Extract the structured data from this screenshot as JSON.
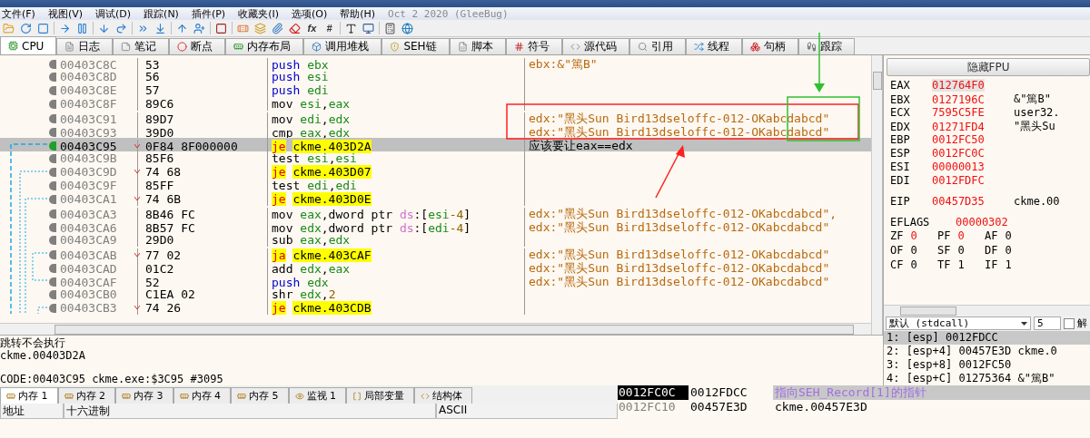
{
  "menu": {
    "items": [
      "文件(F)",
      "视图(V)",
      "调试(D)",
      "跟踪(N)",
      "插件(P)",
      "收藏夹(I)",
      "选项(O)",
      "帮助(H)"
    ],
    "build": "Oct 2 2020 (GleeBug)"
  },
  "toolbar": {
    "text_buttons": [
      "fx",
      "#"
    ]
  },
  "tabs": [
    {
      "label": "CPU",
      "selected": true
    },
    {
      "label": "日志",
      "selected": false
    },
    {
      "label": "笔记",
      "selected": false
    },
    {
      "label": "断点",
      "selected": false
    },
    {
      "label": "内存布局",
      "selected": false
    },
    {
      "label": "调用堆栈",
      "selected": false
    },
    {
      "label": "SEH链",
      "selected": false
    },
    {
      "label": "脚本",
      "selected": false
    },
    {
      "label": "符号",
      "selected": false
    },
    {
      "label": "源代码",
      "selected": false
    },
    {
      "label": "引用",
      "selected": false
    },
    {
      "label": "线程",
      "selected": false
    },
    {
      "label": "句柄",
      "selected": false
    },
    {
      "label": "跟踪",
      "selected": false
    }
  ],
  "disassembly": [
    {
      "address": "00403C8C",
      "bytes": "53",
      "selected": false,
      "kind": "stack",
      "mnemonic": "push",
      "operands": "ebx",
      "comment": {
        "text": "ebx:&\"篤B\"",
        "kind": "auto"
      }
    },
    {
      "address": "00403C8D",
      "bytes": "56",
      "selected": false,
      "kind": "stack",
      "mnemonic": "push",
      "operands": "esi"
    },
    {
      "address": "00403C8E",
      "bytes": "57",
      "selected": false,
      "kind": "stack",
      "mnemonic": "push",
      "operands": "edi"
    },
    {
      "address": "00403C8F",
      "bytes": "89C6",
      "selected": false,
      "kind": "plain",
      "mnemonic": "mov",
      "operands": "esi,eax"
    },
    {
      "address": "00403C91",
      "bytes": "89D7",
      "selected": false,
      "kind": "plain",
      "mnemonic": "mov",
      "operands": "edi,edx",
      "comment": {
        "text": "edx:\"黑头Sun Bird13dseloffc-012-OKabcdabcd\"",
        "kind": "auto"
      }
    },
    {
      "address": "00403C93",
      "bytes": "39D0",
      "selected": false,
      "kind": "plain",
      "mnemonic": "cmp",
      "operands": "eax,edx",
      "comment": {
        "text": "edx:\"黑头Sun Bird13dseloffc-012-OKabcdabcd\"",
        "kind": "auto"
      }
    },
    {
      "address": "00403C95",
      "bytes": "0F84 8F000000",
      "selected": true,
      "kind": "jump",
      "mnemonic": "je",
      "operands": "ckme.403D2A",
      "comment": {
        "text": "应该要让eax==edx",
        "kind": "user"
      }
    },
    {
      "address": "00403C9B",
      "bytes": "85F6",
      "selected": false,
      "kind": "plain",
      "mnemonic": "test",
      "operands": "esi,esi"
    },
    {
      "address": "00403C9D",
      "bytes": "74 68",
      "selected": false,
      "kind": "jump",
      "mnemonic": "je",
      "operands": "ckme.403D07"
    },
    {
      "address": "00403C9F",
      "bytes": "85FF",
      "selected": false,
      "kind": "plain",
      "mnemonic": "test",
      "operands": "edi,edi"
    },
    {
      "address": "00403CA1",
      "bytes": "74 6B",
      "selected": false,
      "kind": "jump",
      "mnemonic": "je",
      "operands": "ckme.403D0E"
    },
    {
      "address": "00403CA3",
      "bytes": "8B46 FC",
      "selected": false,
      "kind": "plain",
      "mnemonic": "mov",
      "operands": "eax,dword ptr ds:[esi-4]",
      "comment": {
        "text": "edx:\"黑头Sun Bird13dseloffc-012-OKabcdabcd\",",
        "kind": "auto"
      }
    },
    {
      "address": "00403CA6",
      "bytes": "8B57 FC",
      "selected": false,
      "kind": "plain",
      "mnemonic": "mov",
      "operands": "edx,dword ptr ds:[edi-4]",
      "comment": {
        "text": "edx:\"黑头Sun Bird13dseloffc-012-OKabcdabcd\"",
        "kind": "auto"
      }
    },
    {
      "address": "00403CA9",
      "bytes": "29D0",
      "selected": false,
      "kind": "plain",
      "mnemonic": "sub",
      "operands": "eax,edx"
    },
    {
      "address": "00403CAB",
      "bytes": "77 02",
      "selected": false,
      "kind": "jump",
      "mnemonic": "ja",
      "operands": "ckme.403CAF",
      "comment": {
        "text": "edx:\"黑头Sun Bird13dseloffc-012-OKabcdabcd\"",
        "kind": "auto"
      }
    },
    {
      "address": "00403CAD",
      "bytes": "01C2",
      "selected": false,
      "kind": "plain",
      "mnemonic": "add",
      "operands": "edx,eax",
      "comment": {
        "text": "edx:\"黑头Sun Bird13dseloffc-012-OKabcdabcd\"",
        "kind": "auto"
      }
    },
    {
      "address": "00403CAF",
      "bytes": "52",
      "selected": false,
      "kind": "stack",
      "mnemonic": "push",
      "operands": "edx",
      "comment": {
        "text": "edx:\"黑头Sun Bird13dseloffc-012-OKabcdabcd\"",
        "kind": "auto"
      }
    },
    {
      "address": "00403CB0",
      "bytes": "C1EA 02",
      "selected": false,
      "kind": "plain",
      "mnemonic": "shr",
      "operands": "edx,2"
    },
    {
      "address": "00403CB3",
      "bytes": "74 26",
      "selected": false,
      "kind": "jump",
      "mnemonic": "je",
      "operands": "ckme.403CDB"
    }
  ],
  "info": {
    "lines": [
      "跳转不会执行",
      "ckme.00403D2A"
    ],
    "location": "CODE:00403C95 ckme.exe:$3C95 #3095"
  },
  "registers": {
    "header": "隐藏FPU",
    "general": [
      {
        "name": "EAX",
        "value": "012764F0",
        "changed": true,
        "selected": true
      },
      {
        "name": "EBX",
        "value": "0127196C",
        "changed": true,
        "selected": false,
        "comment": "&\"篤B\""
      },
      {
        "name": "ECX",
        "value": "7595C5FE",
        "changed": true,
        "selected": false,
        "comment": "user32."
      },
      {
        "name": "EDX",
        "value": "01271FD4",
        "changed": true,
        "selected": false,
        "comment": "\"黑头Su"
      },
      {
        "name": "EBP",
        "value": "0012FC50",
        "changed": true,
        "selected": false
      },
      {
        "name": "ESP",
        "value": "0012FC0C",
        "changed": true,
        "selected": false
      },
      {
        "name": "ESI",
        "value": "00000013",
        "changed": true,
        "selected": false
      },
      {
        "name": "EDI",
        "value": "0012FDFC",
        "changed": true,
        "selected": false
      }
    ],
    "eip": {
      "name": "EIP",
      "value": "00457D35",
      "changed": true,
      "comment": "ckme.00"
    },
    "eflags": {
      "name": "EFLAGS",
      "value": "00000302",
      "changed": true
    },
    "flags": [
      {
        "name": "ZF",
        "value": "0",
        "changed": true
      },
      {
        "name": "PF",
        "value": "0",
        "changed": true
      },
      {
        "name": "AF",
        "value": "0",
        "changed": false
      },
      {
        "name": "OF",
        "value": "0",
        "changed": false
      },
      {
        "name": "SF",
        "value": "0",
        "changed": false
      },
      {
        "name": "DF",
        "value": "0",
        "changed": false
      },
      {
        "name": "CF",
        "value": "0",
        "changed": false
      },
      {
        "name": "TF",
        "value": "1",
        "changed": false
      },
      {
        "name": "IF",
        "value": "1",
        "changed": false
      }
    ]
  },
  "call_args": {
    "convention": "默认 (stdcall)",
    "count": "5",
    "unlock_label": "解",
    "unlock": false,
    "items": [
      {
        "text": "1: [esp] 0012FDCC",
        "selected": true
      },
      {
        "text": "2: [esp+4] 00457E3D ckme.0",
        "selected": false
      },
      {
        "text": "3: [esp+8] 0012FC50",
        "selected": false
      },
      {
        "text": "4: [esp+C] 01275364 &\"篤B\"",
        "selected": false
      }
    ]
  },
  "bottom_tabs": [
    {
      "label": "内存 1",
      "selected": true
    },
    {
      "label": "内存 2",
      "selected": false
    },
    {
      "label": "内存 3",
      "selected": false
    },
    {
      "label": "内存 4",
      "selected": false
    },
    {
      "label": "内存 5",
      "selected": false
    },
    {
      "label": "监视 1",
      "selected": false
    },
    {
      "label": "局部变量",
      "selected": false
    },
    {
      "label": "结构体",
      "selected": false
    }
  ],
  "dump": {
    "columns": [
      "地址",
      "十六进制",
      "ASCII"
    ]
  },
  "stack": [
    {
      "address": "0012FC0C",
      "value": "0012FDCC",
      "comment": "指向SEH_Record[1]的指针",
      "selected": true
    },
    {
      "address": "0012FC10",
      "value": "00457E3D",
      "comment": "ckme.00457E3D",
      "selected": false
    }
  ]
}
